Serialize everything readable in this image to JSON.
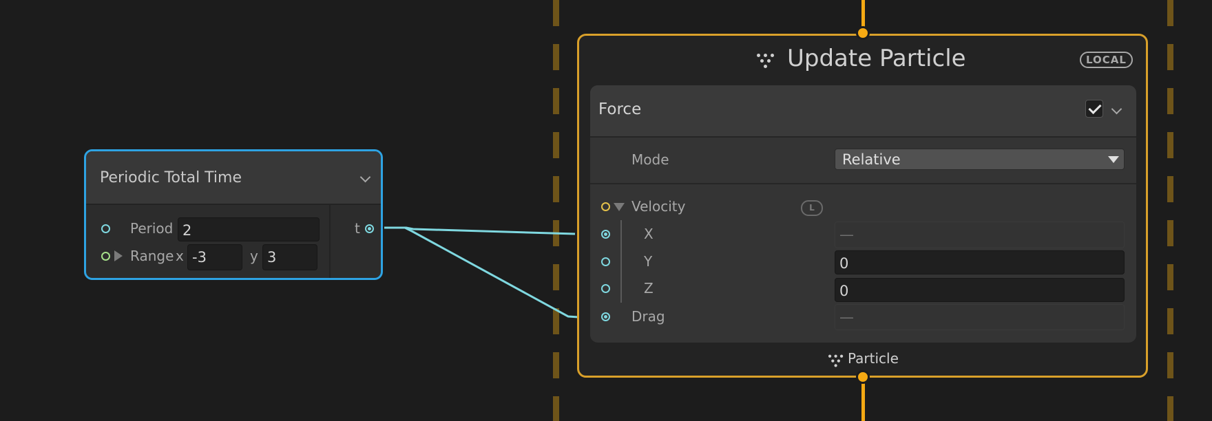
{
  "operator": {
    "title": "Periodic Total Time",
    "output_label": "t",
    "period": {
      "label": "Period",
      "value": "2"
    },
    "range": {
      "label": "Range",
      "x_label": "x",
      "x_value": "-3",
      "y_label": "y",
      "y_value": "3"
    }
  },
  "context": {
    "title": "Update Particle",
    "space_badge": "LOCAL",
    "footer_label": "Particle",
    "block": {
      "title": "Force",
      "enabled": true,
      "mode": {
        "label": "Mode",
        "value": "Relative"
      },
      "velocity": {
        "label": "Velocity",
        "space_badge": "L",
        "x": {
          "label": "X",
          "value": "—"
        },
        "y": {
          "label": "Y",
          "value": "0"
        },
        "z": {
          "label": "Z",
          "value": "0"
        }
      },
      "drag": {
        "label": "Drag",
        "value": "—"
      }
    }
  },
  "colors": {
    "background": "#1c1c1c",
    "operator_border": "#2ea3e3",
    "context_border": "#d9a02a",
    "flow": "#f5a913",
    "edge": "#7fd8e0",
    "system_dash": "#6e5419"
  },
  "icons": [
    "chevron-down-icon",
    "particle-icon",
    "checkmark-icon",
    "dropdown-arrow-icon",
    "expand-triangle-icon"
  ]
}
